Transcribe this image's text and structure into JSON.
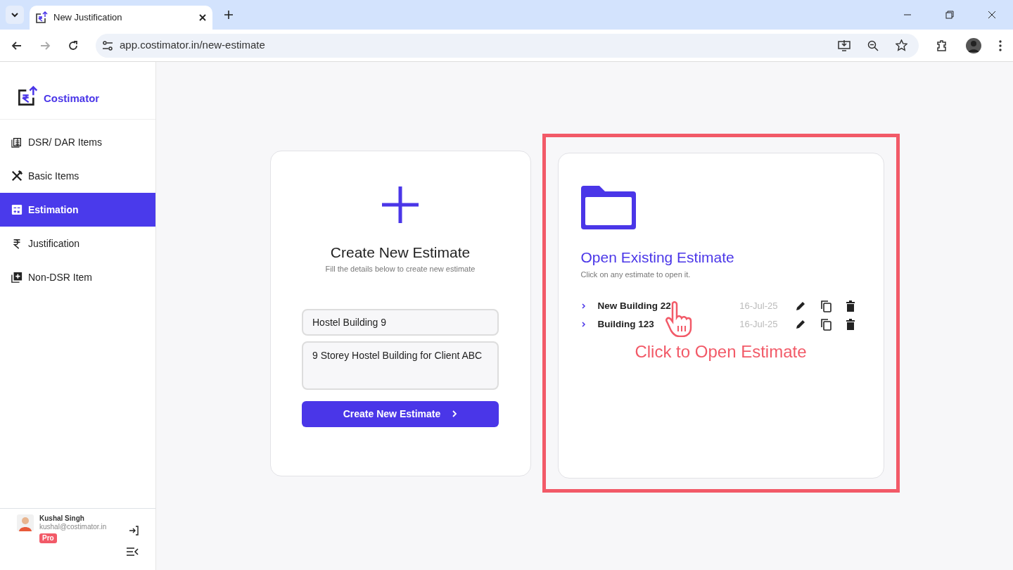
{
  "browser": {
    "tab_title": "New Justification",
    "url": "app.costimator.in/new-estimate"
  },
  "sidebar": {
    "brand": "Costimator",
    "items": [
      {
        "label": "DSR/ DAR Items",
        "selected": false
      },
      {
        "label": "Basic Items",
        "selected": false
      },
      {
        "label": "Estimation",
        "selected": true
      },
      {
        "label": "Justification",
        "selected": false
      },
      {
        "label": "Non-DSR Item",
        "selected": false
      }
    ],
    "user": {
      "name": "Kushal Singh",
      "email": "kushal@costimator.in",
      "badge": "Pro"
    }
  },
  "create_card": {
    "title": "Create New Estimate",
    "subtitle": "Fill the details below to create new estimate",
    "name_value": "Hostel Building 9",
    "description_value": "9 Storey Hostel Building for Client ABC",
    "button": "Create New Estimate"
  },
  "open_card": {
    "title": "Open Existing Estimate",
    "subtitle": "Click on any estimate to open it.",
    "estimates": [
      {
        "name": "New Building 22",
        "date": "16-Jul-25"
      },
      {
        "name": "Building 123",
        "date": "16-Jul-25"
      }
    ],
    "annotation": "Click to Open Estimate"
  }
}
